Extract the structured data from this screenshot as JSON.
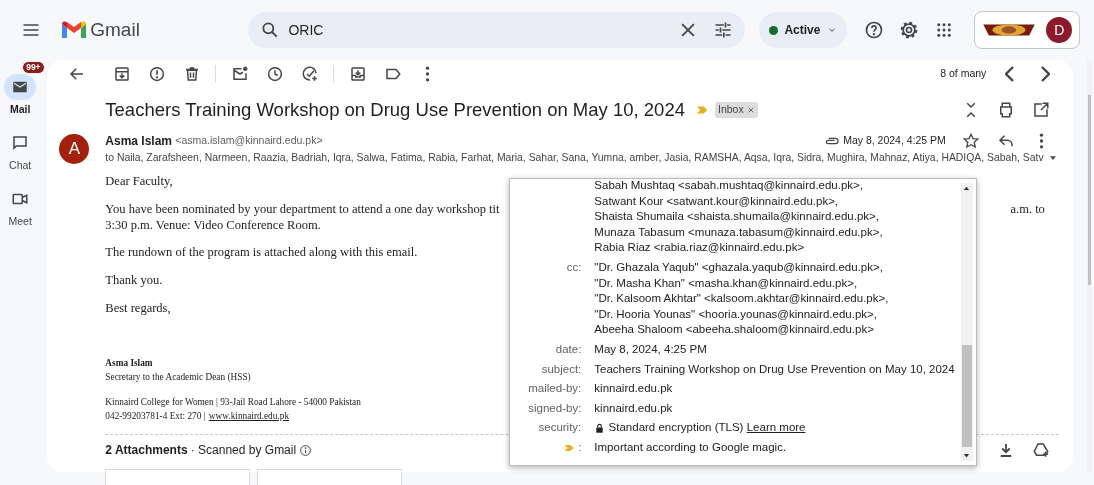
{
  "app": {
    "name": "Gmail"
  },
  "search": {
    "value": "ORIC"
  },
  "status": {
    "label": "Active"
  },
  "account": {
    "initial": "D"
  },
  "rail": [
    {
      "label": "Mail",
      "badge": "99+",
      "selected": true
    },
    {
      "label": "Chat",
      "selected": false
    },
    {
      "label": "Meet",
      "selected": false
    }
  ],
  "toolbar": {
    "pager": "8 of many"
  },
  "message": {
    "subject": "Teachers Training Workshop on Drug Use Prevention on May 10, 2024",
    "important": true,
    "labels": [
      {
        "text": "Inbox"
      }
    ],
    "sender": {
      "initial": "A",
      "name": "Asma Islam",
      "email": "<asma.islam@kinnaird.edu.pk>"
    },
    "has_attachment": true,
    "date": "May 8, 2024, 4:25 PM",
    "starred": false,
    "recipients": "to Naila, Zarafsheen, Narmeen, Raazia, Badriah, Iqra, Salwa, Fatima, Rabia, Farhat, Maria, Sahar, Sana, Yumna, amber, Jasia, RAMSHA, Aqsa, Iqra, Sidra, Mughira, Mahnaz, Atiya, HADIQA, Sabah, Satv",
    "body": [
      {
        "kind": "text",
        "text": "Dear Faculty,"
      },
      {
        "kind": "split",
        "left": "You have been nominated by your department to attend a one day workshop tit",
        "right": "a.m. to",
        "rest": "3:30 p.m. Venue: Video Conference Room."
      },
      {
        "kind": "text",
        "text": "The rundown of the program is attached along with this email."
      },
      {
        "kind": "text",
        "text": "Thank you."
      },
      {
        "kind": "text",
        "text": "Best regards,"
      }
    ],
    "signature": {
      "name": "Asma Islam",
      "title": "Secretary to the Academic Dean (HSS)",
      "address": "Kinnaird College for Women | 93-Jail Road Lahore - 54000 Pakistan",
      "phone": "042-99203781-4 Ext: 270 |",
      "link": "www.kinnaird.edu.pk"
    },
    "attachments": {
      "heading": "2 Attachments",
      "separator": "·",
      "scanned": "Scanned by Gmail",
      "files": [
        {
          "kind": "document"
        },
        {
          "kind": "document"
        }
      ]
    }
  },
  "details_popup": {
    "rows": [
      {
        "kind": "lines",
        "label": "",
        "lines": [
          "Sabah Mushtaq <sabah.mushtaq@kinnaird.edu.pk>,",
          "Satwant Kour <satwant.kour@kinnaird.edu.pk>,",
          "Shaista Shumaila <shaista.shumaila@kinnaird.edu.pk>,",
          "Munaza Tabasum <munaza.tabasum@kinnaird.edu.pk>,",
          "Rabia Riaz <rabia.riaz@kinnaird.edu.pk>"
        ]
      },
      {
        "kind": "lines",
        "label": "cc:",
        "lines": [
          "\"Dr. Ghazala Yaqub\" <ghazala.yaqub@kinnaird.edu.pk>,",
          "\"Dr. Masha Khan\" <masha.khan@kinnaird.edu.pk>,",
          "\"Dr. Kalsoom Akhtar\" <kalsoom.akhtar@kinnaird.edu.pk>,",
          "\"Dr. Hooria Younas\" <hooria.younas@kinnaird.edu.pk>,",
          "Abeeha Shaloom <abeeha.shaloom@kinnaird.edu.pk>"
        ]
      },
      {
        "kind": "lines",
        "label": "date:",
        "lines": [
          "May 8, 2024, 4:25 PM"
        ]
      },
      {
        "kind": "lines",
        "label": "subject:",
        "lines": [
          "Teachers Training Workshop on Drug Use Prevention on May 10, 2024"
        ]
      },
      {
        "kind": "lines",
        "label": "mailed-by:",
        "lines": [
          "kinnaird.edu.pk"
        ]
      },
      {
        "kind": "lines",
        "label": "signed-by:",
        "lines": [
          "kinnaird.edu.pk"
        ]
      },
      {
        "kind": "security",
        "label": "security:",
        "text": "Standard encryption (TLS)",
        "link": "Learn more"
      },
      {
        "kind": "importance",
        "label": ":",
        "text": "Important according to Google magic."
      }
    ]
  }
}
